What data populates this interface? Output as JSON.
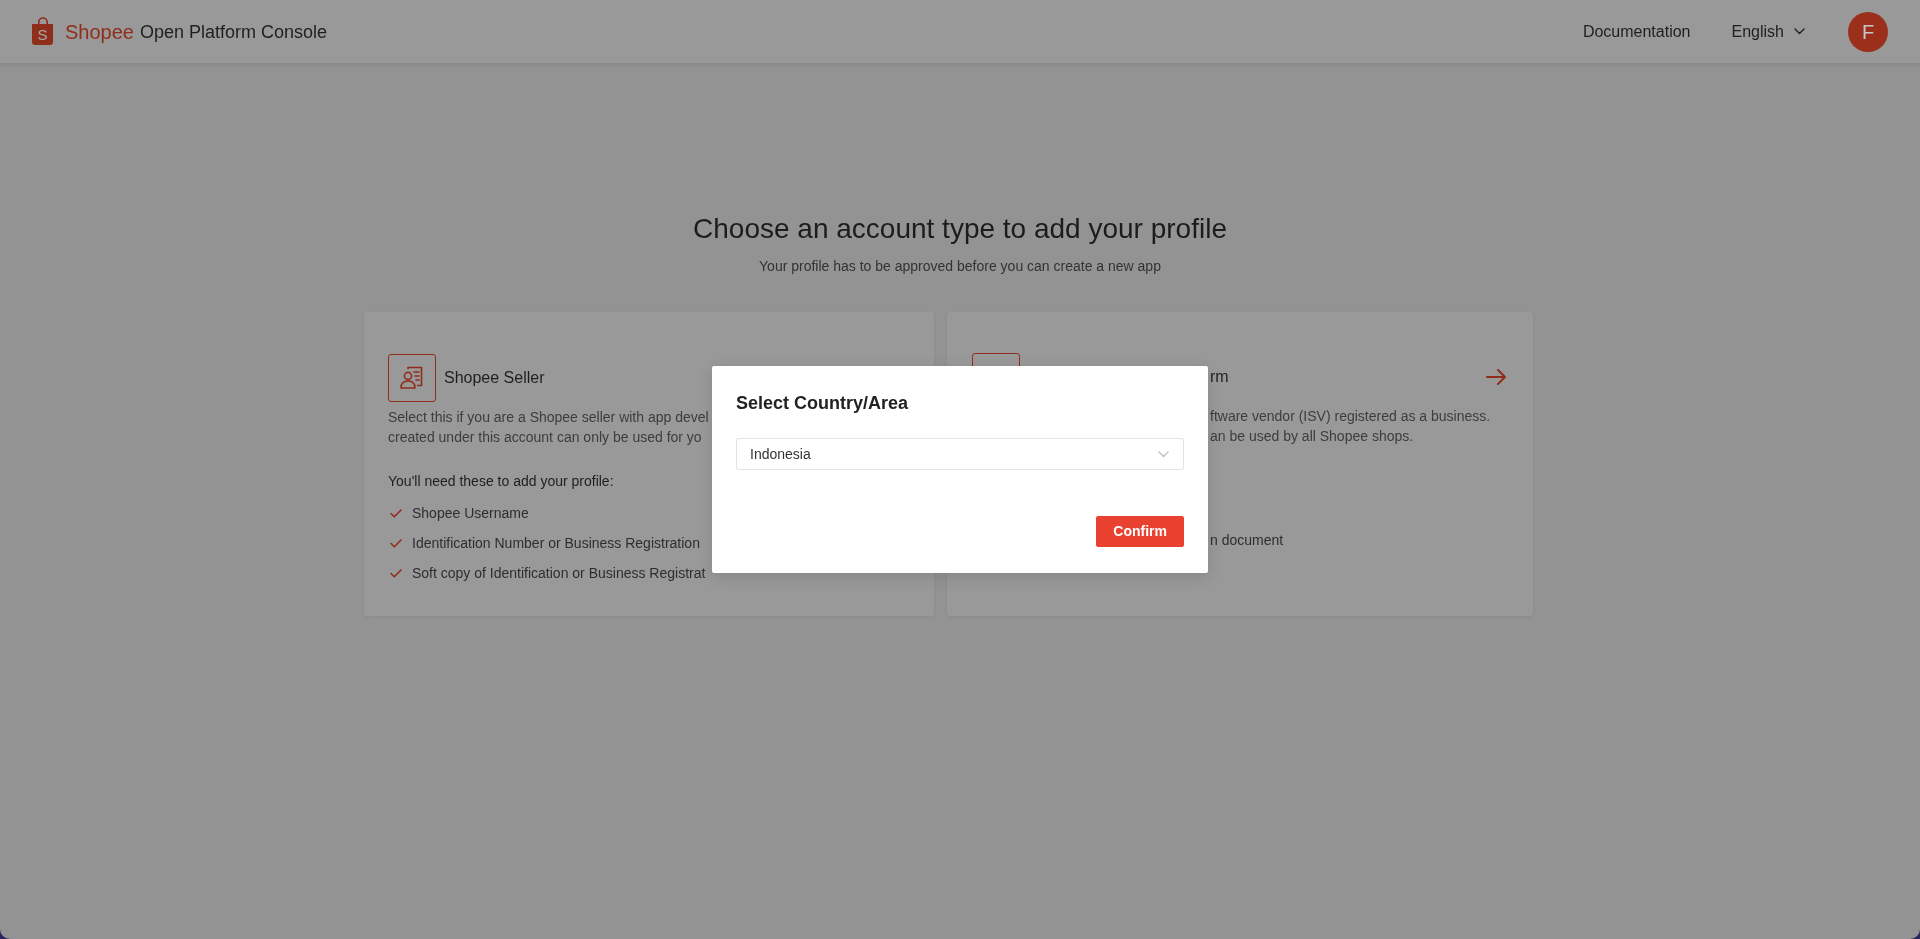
{
  "header": {
    "logo": {
      "letter": "S",
      "brand": "Shopee",
      "product": "Open Platform Console"
    },
    "links": [
      {
        "label": "Documentation"
      }
    ],
    "language": {
      "label": "English"
    },
    "avatar": {
      "initial": "F"
    }
  },
  "intro": {
    "title": "Choose an account type to add your profile",
    "subtitle": "Your profile has to be approved before you can create a new app"
  },
  "cards": [
    {
      "kind": "full",
      "title": "Shopee Seller",
      "description": [
        "Select this if you are a Shopee seller with app devel",
        "created under this account can only be used for yo"
      ],
      "requirements_heading": "You'll need these to add your profile:",
      "requirements": [
        "Shopee Username",
        "Identification Number or Business Registration",
        "Soft copy of Identification or Business Registrat"
      ]
    },
    {
      "kind": "covered",
      "title": "rm",
      "arrow": true,
      "description": [
        "ftware vendor (ISV) registered as a business.",
        "an be used by all Shopee shops."
      ],
      "requirements": [
        "n document"
      ]
    }
  ],
  "dialog": {
    "title": "Select Country/Area",
    "select": {
      "value": "Indonesia"
    },
    "buttons": [
      {
        "label": "Confirm",
        "kind": "primary"
      }
    ]
  }
}
